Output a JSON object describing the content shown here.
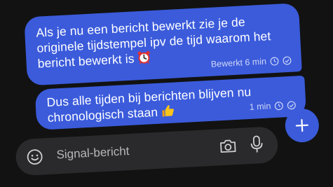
{
  "messages": [
    {
      "text": "Als je nu een bericht bewerkt zie je de\noriginele tijdstempel ipv de tijd waarom het\nbericht bewerkt is",
      "emoji": "alarm-clock",
      "meta": "Bewerkt 6 min"
    },
    {
      "text": "Dus alle tijden bij berichten blijven nu\nchronologisch staan",
      "emoji": "thumbs-up",
      "meta": "1 min"
    }
  ],
  "composer": {
    "placeholder": "Signal-bericht"
  },
  "colors": {
    "background": "#121212",
    "bubble": "#3b5bdb",
    "composer": "#2a2a2c",
    "placeholder": "#b8b8bc"
  }
}
